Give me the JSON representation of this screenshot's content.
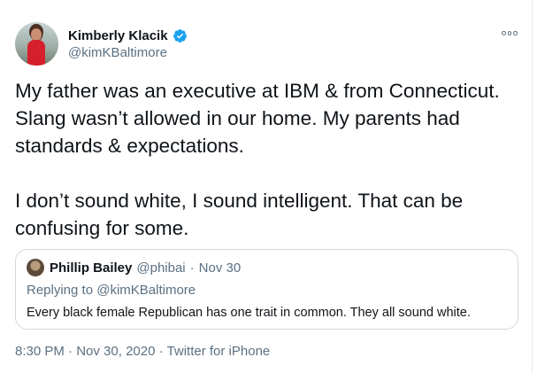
{
  "author": {
    "name": "Kimberly Klacik",
    "handle": "@kimKBaltimore",
    "verified_icon": "verified-badge-icon",
    "avatar_icon": "profile-avatar"
  },
  "tweet": {
    "text": "My father was an executive at IBM & from Connecticut. Slang wasn’t allowed in our home. My parents had standards & expectations.\n\nI don’t sound white, I sound intelligent. That can be confusing for some.",
    "time": "8:30 PM",
    "sep1": "·",
    "date": "Nov 30, 2020",
    "sep2": "·",
    "source": "Twitter for iPhone"
  },
  "quoted_tweet": {
    "name": "Phillip Bailey",
    "handle": "@phibai",
    "sep": "·",
    "date": "Nov 30",
    "replying_prefix": "Replying to",
    "replying_to": "@kimKBaltimore",
    "text": "Every black female Republican has one trait in common. They all sound white."
  },
  "colors": {
    "verified": "#1da1f2",
    "muted": "#5b7083",
    "text": "#0f1419",
    "border": "#cfd9de"
  }
}
